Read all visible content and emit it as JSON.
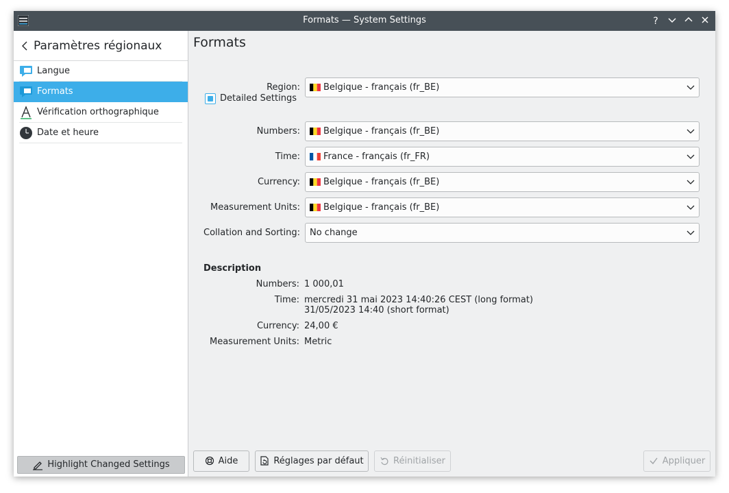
{
  "window": {
    "title": "Formats — System Settings"
  },
  "titlebar_buttons": {
    "help": "?",
    "minimize": "⌄",
    "maximize": "⌃",
    "close": "✕"
  },
  "sidebar": {
    "back_title": "Paramètres régionaux",
    "items": [
      {
        "label": "Langue",
        "icon": "speech-bubble-icon"
      },
      {
        "label": "Formats",
        "icon": "speech-bubble-icon",
        "active": true
      },
      {
        "label": "Vérification orthographique",
        "icon": "spellcheck-icon"
      },
      {
        "label": "Date et heure",
        "icon": "clock-icon"
      }
    ],
    "highlight_button": "Highlight Changed Settings"
  },
  "main": {
    "title": "Formats",
    "region": {
      "label": "Region:",
      "value": "Belgique - français (fr_BE)",
      "flag": "be"
    },
    "detailed_settings": {
      "label": "Detailed Settings",
      "checked": true
    },
    "numbers": {
      "label": "Numbers:",
      "value": "Belgique - français (fr_BE)",
      "flag": "be"
    },
    "time": {
      "label": "Time:",
      "value": "France - français (fr_FR)",
      "flag": "fr"
    },
    "currency": {
      "label": "Currency:",
      "value": "Belgique - français (fr_BE)",
      "flag": "be"
    },
    "measurement": {
      "label": "Measurement Units:",
      "value": "Belgique - français (fr_BE)",
      "flag": "be"
    },
    "collation": {
      "label": "Collation and Sorting:",
      "value": "No change"
    },
    "description": {
      "title": "Description",
      "numbers_label": "Numbers:",
      "numbers_value": "1 000,01",
      "time_label": "Time:",
      "time_long": "mercredi 31 mai 2023 14:40:26 CEST (long format)",
      "time_short": "31/05/2023 14:40 (short format)",
      "currency_label": "Currency:",
      "currency_value": "24,00 €",
      "measurement_label": "Measurement Units:",
      "measurement_value": "Metric"
    }
  },
  "footer": {
    "help": "Aide",
    "defaults": "Réglages par défaut",
    "reset": "Réinitialiser",
    "apply": "Appliquer"
  },
  "colors": {
    "accent": "#3daee9",
    "titlebar": "#475057",
    "window_bg": "#eff0f1"
  }
}
